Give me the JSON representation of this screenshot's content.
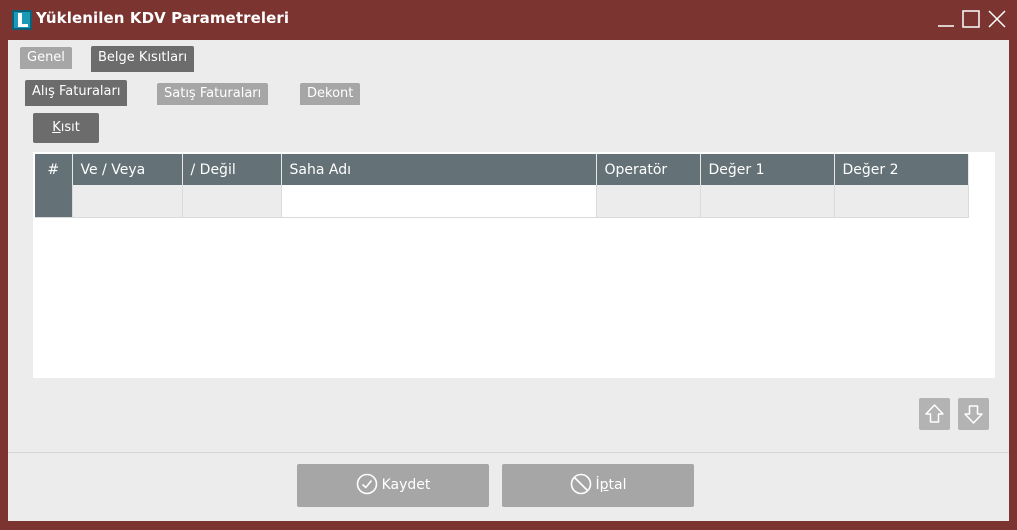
{
  "window": {
    "title": "Yüklenilen KDV Parametreleri"
  },
  "colors": {
    "frame": "#7b3430",
    "client_bg": "#ececec",
    "tab_active": "#6c6c6c",
    "tab_inactive": "#a6a6a6",
    "grid_header": "#647176",
    "button_disabled": "#a6a6a6"
  },
  "tabs_top": [
    {
      "label": "Genel",
      "active": false
    },
    {
      "label": "Belge Kısıtları",
      "active": true
    }
  ],
  "tabs_sub": [
    {
      "label": "Alış Faturaları",
      "active": true
    },
    {
      "label": "Satış Faturaları",
      "active": false
    },
    {
      "label": "Dekont",
      "active": false
    }
  ],
  "toolbar": {
    "kisit_label_first": "K",
    "kisit_label_rest": "ısıt"
  },
  "grid": {
    "columns": [
      "#",
      "Ve / Veya",
      "/ Değil",
      "Saha Adı",
      "Operatör",
      "Değer 1",
      "Değer 2"
    ],
    "rows": [
      [
        "",
        "",
        "",
        "",
        "",
        "",
        ""
      ]
    ]
  },
  "footer": {
    "save_label": "Kaydet",
    "cancel_label_first": "İ",
    "cancel_label_underlined": "p",
    "cancel_label_rest": "tal"
  },
  "icons": {
    "app": "logo-l-icon",
    "minimize": "minimize-icon",
    "maximize": "maximize-icon",
    "close": "close-icon",
    "move_up": "arrow-up-icon",
    "move_down": "arrow-down-icon",
    "save": "check-circle-icon",
    "cancel": "no-entry-icon"
  }
}
